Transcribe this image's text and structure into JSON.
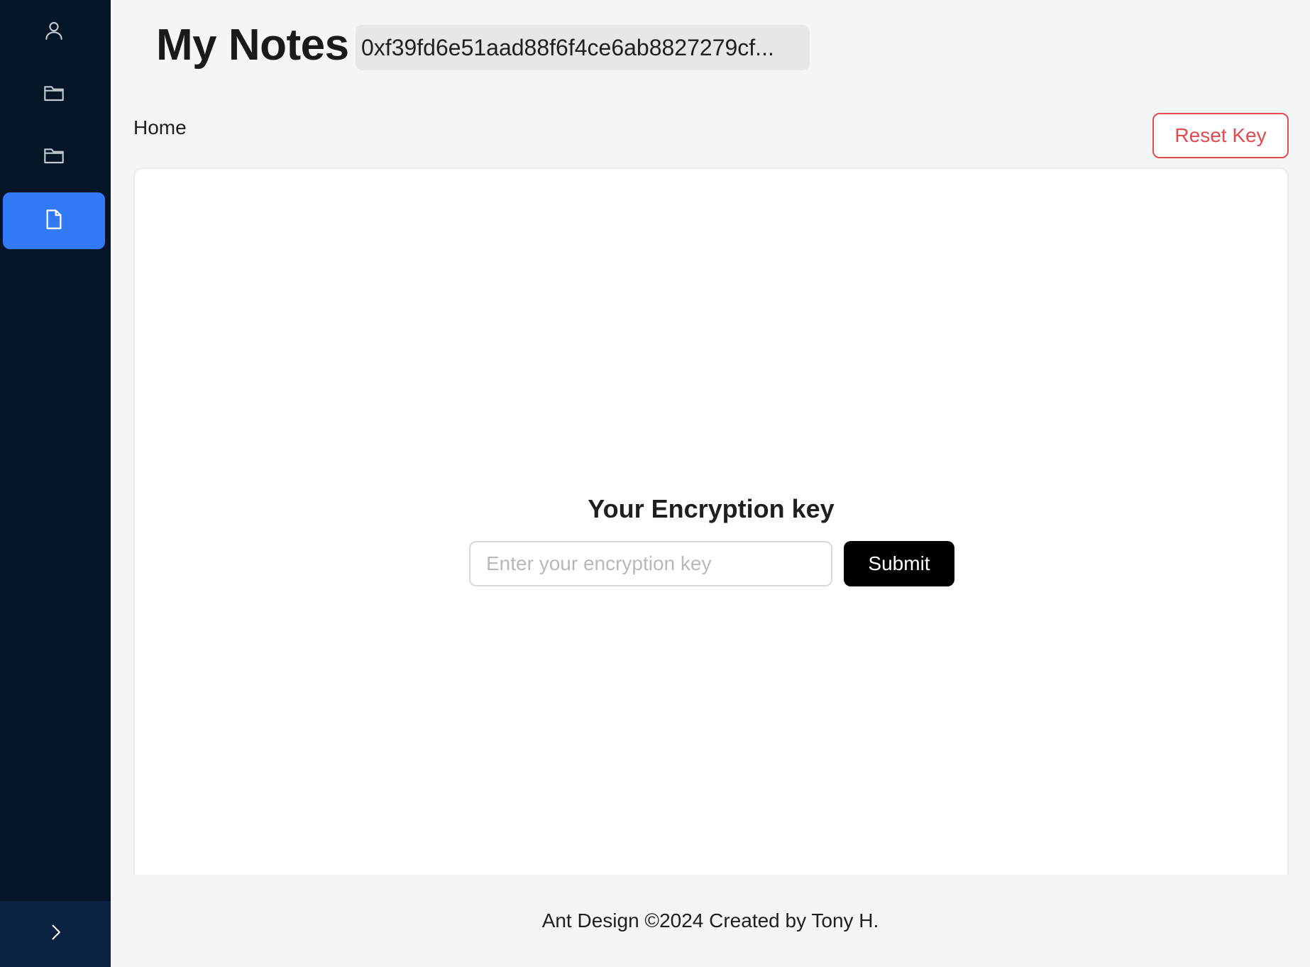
{
  "sidebar": {
    "items": [
      {
        "icon": "user-icon",
        "active": false
      },
      {
        "icon": "folder-icon",
        "active": false
      },
      {
        "icon": "folder-icon",
        "active": false
      },
      {
        "icon": "file-icon",
        "active": true
      }
    ],
    "trigger_icon": "chevron-right-icon"
  },
  "header": {
    "title": "My Notes",
    "address": "0xf39fd6e51aad88f6f4ce6ab8827279cf..."
  },
  "breadcrumb": {
    "current": "Home"
  },
  "actions": {
    "reset_label": "Reset Key"
  },
  "encryption": {
    "title": "Your Encryption key",
    "input_value": "",
    "input_placeholder": "Enter your encryption key",
    "submit_label": "Submit"
  },
  "footer": {
    "text": "Ant Design ©2024 Created by Tony H."
  },
  "colors": {
    "sidebar_bg": "#041528",
    "active_item": "#3279f5",
    "danger": "#e14a4f",
    "primary_button": "#000000"
  }
}
